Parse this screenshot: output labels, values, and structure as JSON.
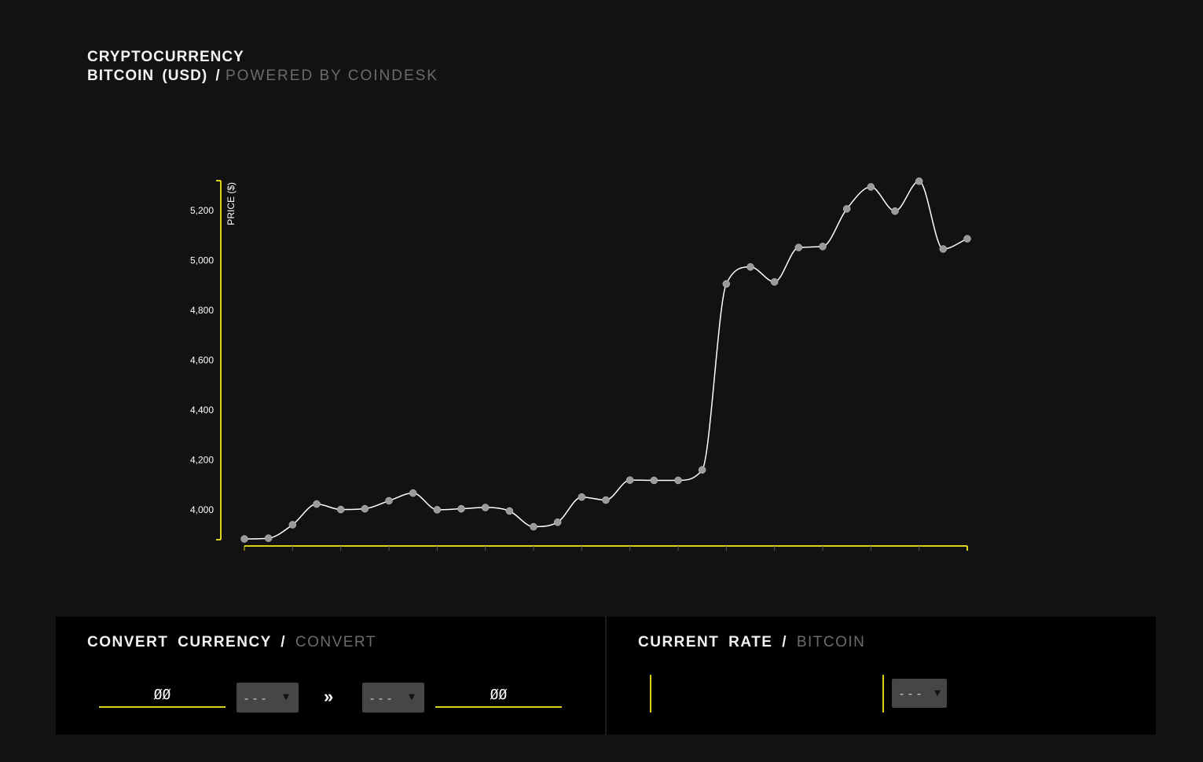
{
  "header": {
    "line1": "CRYPTOCURRENCY",
    "title": "BITCOIN  (USD) /",
    "subtitle": "POWERED  BY  COINDESK"
  },
  "colors": {
    "background": "#121212",
    "panel": "#000000",
    "accent": "#d9d31e",
    "line": "#ffffff",
    "point": "#9a9a9a",
    "muted": "#6b6b6b"
  },
  "chart_data": {
    "type": "line",
    "title": "",
    "xlabel": "",
    "ylabel": "PRICE ($)",
    "ylim": [
      3880,
      5320
    ],
    "yticks": [
      4000,
      4200,
      4400,
      4600,
      4800,
      5000,
      5200
    ],
    "ytick_labels": [
      "4,000",
      "4,200",
      "4,400",
      "4,600",
      "4,800",
      "5,000",
      "5,200"
    ],
    "x_tick_labels_visible": false,
    "grid": false,
    "legend": "none",
    "x": [
      1,
      2,
      3,
      4,
      5,
      6,
      7,
      8,
      9,
      10,
      11,
      12,
      13,
      14,
      15,
      16,
      17,
      18,
      19,
      20,
      21,
      22,
      23,
      24,
      25,
      26,
      27,
      28,
      29,
      30,
      31
    ],
    "series": [
      {
        "values": [
          3883,
          3886,
          3940,
          4023,
          4001,
          4004,
          4036,
          4067,
          4000,
          4004,
          4009,
          3995,
          3932,
          3950,
          4051,
          4039,
          4119,
          4118,
          4118,
          4160,
          4906,
          4974,
          4914,
          5052,
          5056,
          5207,
          5295,
          5198,
          5318,
          5046,
          5087
        ]
      }
    ]
  },
  "converter": {
    "title": "CONVERT  CURRENCY /",
    "subtitle": "CONVERT",
    "from_amount": "ØØ",
    "from_currency": "---",
    "arrow": "»",
    "to_currency": "---",
    "to_amount": "ØØ"
  },
  "rate": {
    "title": "CURRENT  RATE /",
    "subtitle": "BITCOIN",
    "currency": "---"
  },
  "icons": {
    "caret": "▼"
  }
}
